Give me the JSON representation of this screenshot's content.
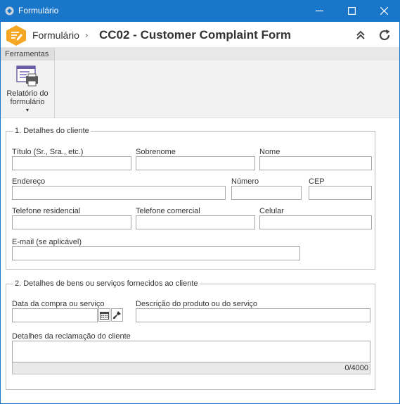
{
  "window": {
    "title": "Formulário",
    "controls": [
      "minimize-icon",
      "maximize-icon",
      "close-icon"
    ]
  },
  "header": {
    "breadcrumb_root": "Formulário",
    "separator": "›",
    "form_title": "CC02 - Customer Complaint Form",
    "buttons": [
      "collapse-icon",
      "refresh-icon"
    ]
  },
  "toolbar": {
    "tab_label": "Ferramentas",
    "report_button": {
      "line1": "Relatório do",
      "line2": "formulário",
      "caret": "▾",
      "icon": "form-report-icon"
    }
  },
  "section1": {
    "legend": "1. Detalhes do cliente",
    "fields": {
      "titulo": {
        "label": "Título (Sr., Sra., etc.)",
        "value": ""
      },
      "sobrenome": {
        "label": "Sobrenome",
        "value": ""
      },
      "nome": {
        "label": "Nome",
        "value": ""
      },
      "endereco": {
        "label": "Endereço",
        "value": ""
      },
      "numero": {
        "label": "Número",
        "value": ""
      },
      "cep": {
        "label": "CEP",
        "value": ""
      },
      "telefone_residencial": {
        "label": "Telefone residencial",
        "value": ""
      },
      "telefone_comercial": {
        "label": "Telefone comercial",
        "value": ""
      },
      "celular": {
        "label": "Celular",
        "value": ""
      },
      "email": {
        "label": "E-mail (se aplicável)",
        "value": ""
      }
    }
  },
  "section2": {
    "legend": "2. Detalhes de bens ou serviços fornecidos ao cliente",
    "fields": {
      "data_compra": {
        "label": "Data da compra ou serviço",
        "value": ""
      },
      "descricao": {
        "label": "Descrição do produto ou do serviço",
        "value": ""
      },
      "detalhes": {
        "label": "Detalhes da reclamação do cliente",
        "value": "",
        "counter": "0/4000"
      }
    }
  },
  "colors": {
    "titlebar": "#1976c8",
    "hex_badge": "#f5a623",
    "field_border": "#a8a8a8"
  }
}
